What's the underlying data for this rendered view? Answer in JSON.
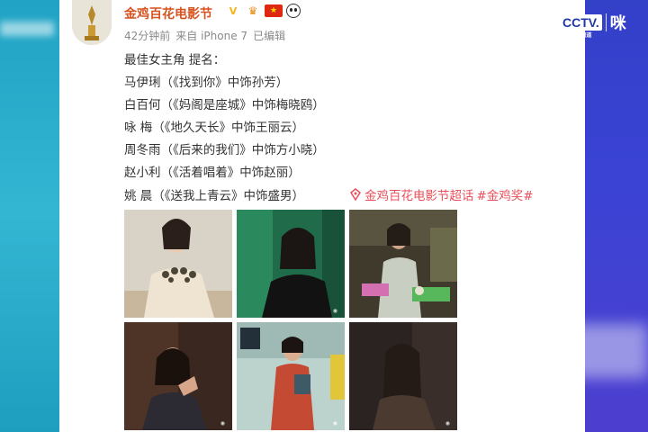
{
  "post": {
    "author": "金鸡百花电影节",
    "time": "42分钟前",
    "source": "来自 iPhone 7",
    "edited": "已编辑",
    "heading": "最佳女主角 提名：",
    "nominees": [
      "马伊琍（《找到你》中饰孙芳）",
      "白百何（《妈阁是座城》中饰梅晓鸥）",
      "咏  梅（《地久天长》中饰王丽云）",
      "周冬雨（《后来的我们》中饰方小晓）",
      "赵小利（《活着唱着》中饰赵丽）",
      "姚  晨（《送我上青云》中饰盛男）"
    ],
    "topic": "金鸡百花电影节超话",
    "hashtag": "#金鸡奖#"
  },
  "broadcaster": {
    "logo": "CCTV.",
    "sub": "体育频道",
    "partner": "咪"
  },
  "colors": {
    "author": "#d6521f",
    "link": "#e8505b",
    "left_bg": "#2aa7c7",
    "right_bg": "#3a43d4"
  }
}
